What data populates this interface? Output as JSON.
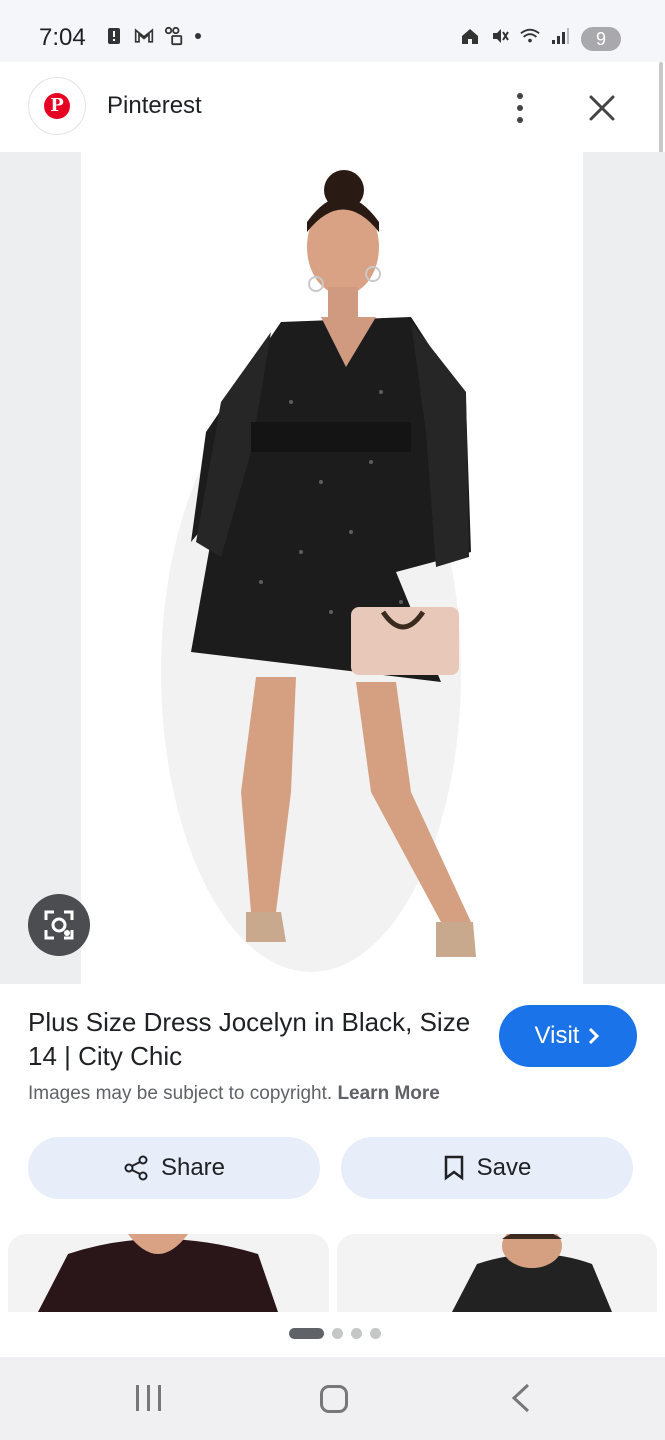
{
  "status_bar": {
    "time": "7:04",
    "battery_level": "9",
    "left_icons": [
      "alert-icon",
      "gmail-icon",
      "vpn-lock-icon",
      "dot-icon"
    ],
    "right_icons": [
      "home-icon",
      "mute-icon",
      "wifi-icon",
      "signal-icon",
      "battery-icon"
    ]
  },
  "header": {
    "app_name": "Pinterest",
    "logo_letter": "P",
    "brand_color": "#e60023"
  },
  "image": {
    "description_icons": [
      "visual-search-icon"
    ]
  },
  "product": {
    "title": "Plus Size Dress Jocelyn in Black, Size 14 | City Chic",
    "visit_label": "Visit",
    "copyright_text": "Images may be subject to copyright.",
    "learn_more_label": "Learn More"
  },
  "actions": {
    "share_label": "Share",
    "save_label": "Save"
  },
  "pager": {
    "current": 1,
    "total": 4
  },
  "colors": {
    "accent": "#1a73e8",
    "button_bg": "#e8eef9"
  }
}
